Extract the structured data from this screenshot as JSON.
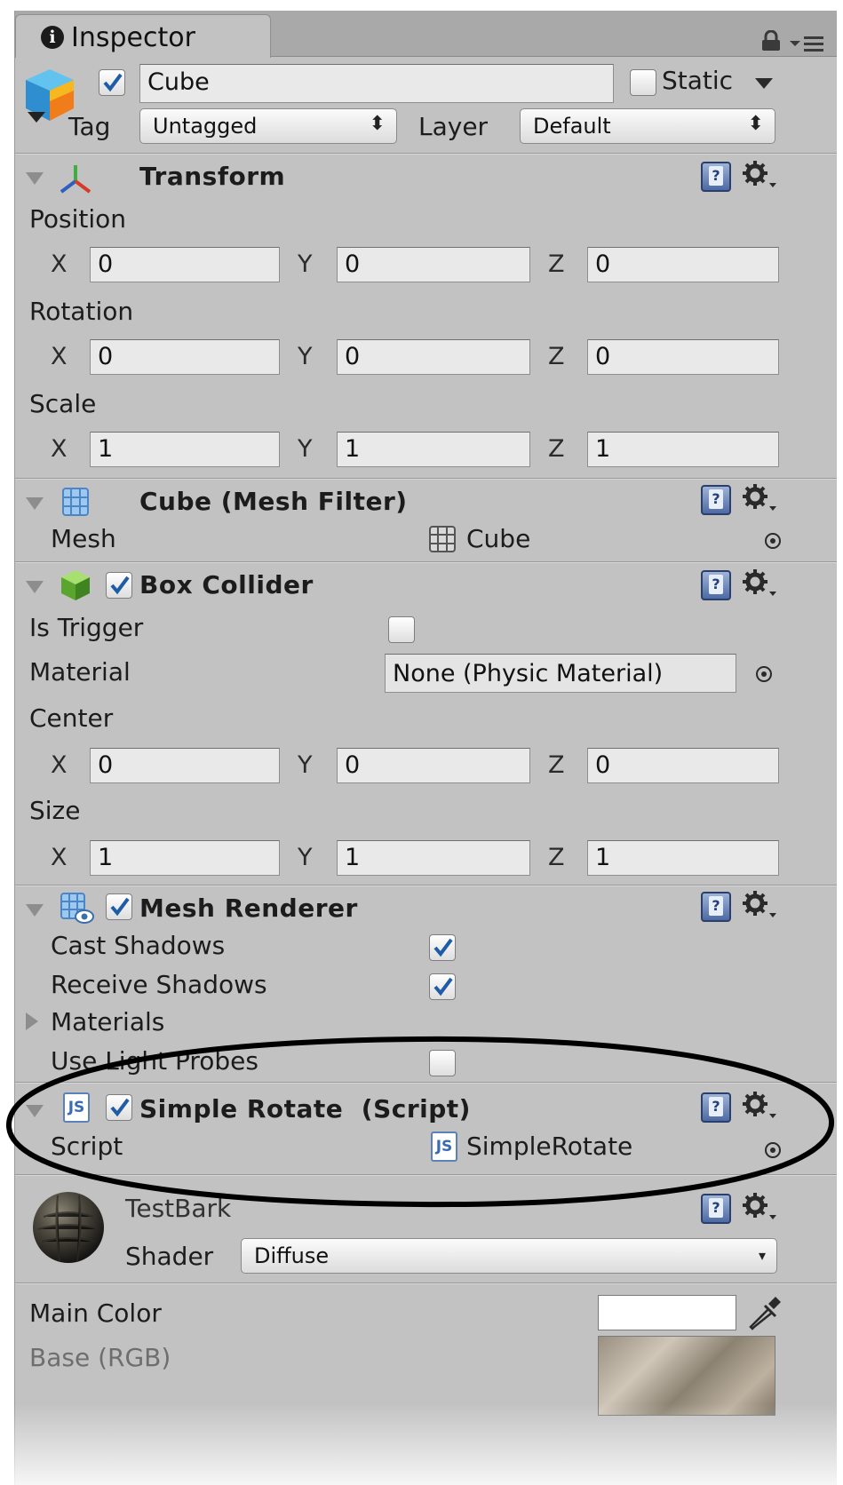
{
  "tab": {
    "title": "Inspector"
  },
  "gameobject": {
    "name": "Cube",
    "active": true,
    "static_label": "Static",
    "static": false,
    "tag_label": "Tag",
    "tag_value": "Untagged",
    "layer_label": "Layer",
    "layer_value": "Default"
  },
  "transform": {
    "title": "Transform",
    "position_label": "Position",
    "position": {
      "x": "0",
      "y": "0",
      "z": "0"
    },
    "rotation_label": "Rotation",
    "rotation": {
      "x": "0",
      "y": "0",
      "z": "0"
    },
    "scale_label": "Scale",
    "scale": {
      "x": "1",
      "y": "1",
      "z": "1"
    }
  },
  "axes": {
    "x": "X",
    "y": "Y",
    "z": "Z"
  },
  "mesh_filter": {
    "title": "Cube (Mesh Filter)",
    "mesh_label": "Mesh",
    "mesh_value": "Cube"
  },
  "box_collider": {
    "title": "Box Collider",
    "enabled": true,
    "is_trigger_label": "Is Trigger",
    "is_trigger": false,
    "material_label": "Material",
    "material_value": "None (Physic Material)",
    "center_label": "Center",
    "center": {
      "x": "0",
      "y": "0",
      "z": "0"
    },
    "size_label": "Size",
    "size": {
      "x": "1",
      "y": "1",
      "z": "1"
    }
  },
  "mesh_renderer": {
    "title": "Mesh Renderer",
    "enabled": true,
    "cast_shadows_label": "Cast Shadows",
    "cast_shadows": true,
    "receive_shadows_label": "Receive Shadows",
    "receive_shadows": true,
    "materials_label": "Materials",
    "use_light_probes_label": "Use Light Probes",
    "use_light_probes": false
  },
  "script_component": {
    "title": "Simple Rotate  (Script)",
    "enabled": true,
    "script_label": "Script",
    "script_value": "SimpleRotate"
  },
  "material": {
    "name": "TestBark",
    "shader_label": "Shader",
    "shader_value": "Diffuse",
    "main_color_label": "Main Color",
    "main_color": "#ffffff",
    "base_label": "Base (RGB)"
  },
  "icons": {
    "info": "info-icon",
    "lock": "lock-icon",
    "menu": "tab-menu-icon",
    "help": "help-icon",
    "gear": "gear-icon",
    "picker": "object-picker-icon",
    "eyedropper": "eyedropper-icon",
    "js": "javascript-file-icon"
  },
  "colors": {
    "panel": "#c2c2c2",
    "field": "#e9e9e9",
    "annotation": "#000000"
  }
}
